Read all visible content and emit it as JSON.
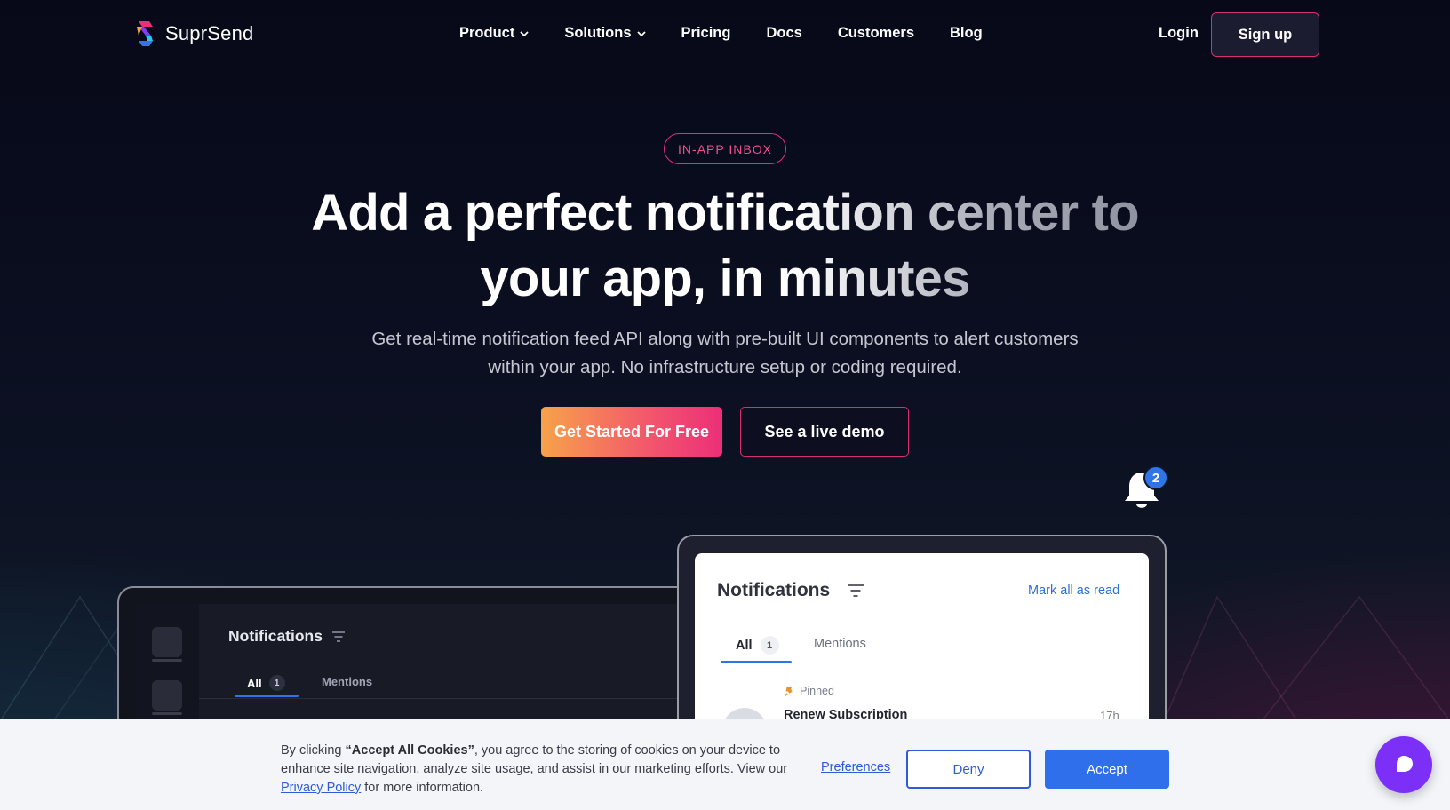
{
  "brand": {
    "name": "SuprSend"
  },
  "nav": {
    "items": [
      {
        "label": "Product",
        "has_dropdown": true
      },
      {
        "label": "Solutions",
        "has_dropdown": true
      },
      {
        "label": "Pricing",
        "has_dropdown": false
      },
      {
        "label": "Docs",
        "has_dropdown": false
      },
      {
        "label": "Customers",
        "has_dropdown": false
      },
      {
        "label": "Blog",
        "has_dropdown": false
      }
    ],
    "login_label": "Login",
    "signup_label": "Sign up"
  },
  "hero": {
    "pill": "IN-APP INBOX",
    "title_line1": "Add a perfect notification center to",
    "title_line2": "your app, in minutes",
    "subtitle": "Get real-time notification feed API along with pre-built UI components to alert customers within your app. No infrastructure setup or coding required.",
    "cta_primary": "Get Started For Free",
    "cta_secondary": "See a live demo"
  },
  "bell": {
    "badge_count": "2"
  },
  "dark_mockup": {
    "title": "Notifications",
    "tab_all": "All",
    "tab_all_count": "1",
    "tab_mentions": "Mentions"
  },
  "light_mockup": {
    "title": "Notifications",
    "mark_all_read": "Mark all as read",
    "tab_all": "All",
    "tab_all_count": "1",
    "tab_mentions": "Mentions",
    "pinned_label": "Pinned",
    "notification_title": "Renew Subscription",
    "notification_time": "17h"
  },
  "cookie": {
    "text_prefix": "By clicking ",
    "text_bold": "“Accept All Cookies”",
    "text_middle": ", you agree to the storing of cookies on your device to enhance site navigation, analyze site usage, and assist in our marketing efforts. View our ",
    "privacy_link": "Privacy Policy",
    "text_suffix": " for more information.",
    "preferences_label": "Preferences",
    "deny_label": "Deny",
    "accept_label": "Accept"
  },
  "colors": {
    "accent_pink": "#e0307a",
    "accent_blue": "#2f74e8",
    "chat_purple": "#7b2ff7"
  },
  "icons": {
    "logo": "suprsend-logo-icon",
    "dropdown": "chevron-down-icon",
    "bell": "bell-icon",
    "filter": "filter-icon",
    "pin": "pin-icon",
    "chat": "chat-icon"
  }
}
